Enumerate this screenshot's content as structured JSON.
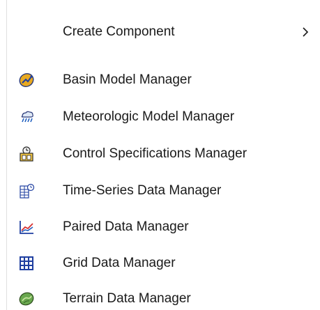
{
  "menu": {
    "submenu_item": {
      "label": "Create Component",
      "arrow_icon": "chevron-right-icon"
    },
    "items": [
      {
        "label": "Basin Model Manager",
        "icon": "basin-model-icon"
      },
      {
        "label": "Meteorologic Model Manager",
        "icon": "meteorologic-model-icon"
      },
      {
        "label": "Control Specifications Manager",
        "icon": "control-specifications-icon"
      },
      {
        "label": "Time-Series Data Manager",
        "icon": "time-series-data-icon"
      },
      {
        "label": "Paired Data Manager",
        "icon": "paired-data-icon"
      },
      {
        "label": "Grid Data Manager",
        "icon": "grid-data-icon"
      },
      {
        "label": "Terrain Data Manager",
        "icon": "terrain-data-icon"
      }
    ]
  }
}
